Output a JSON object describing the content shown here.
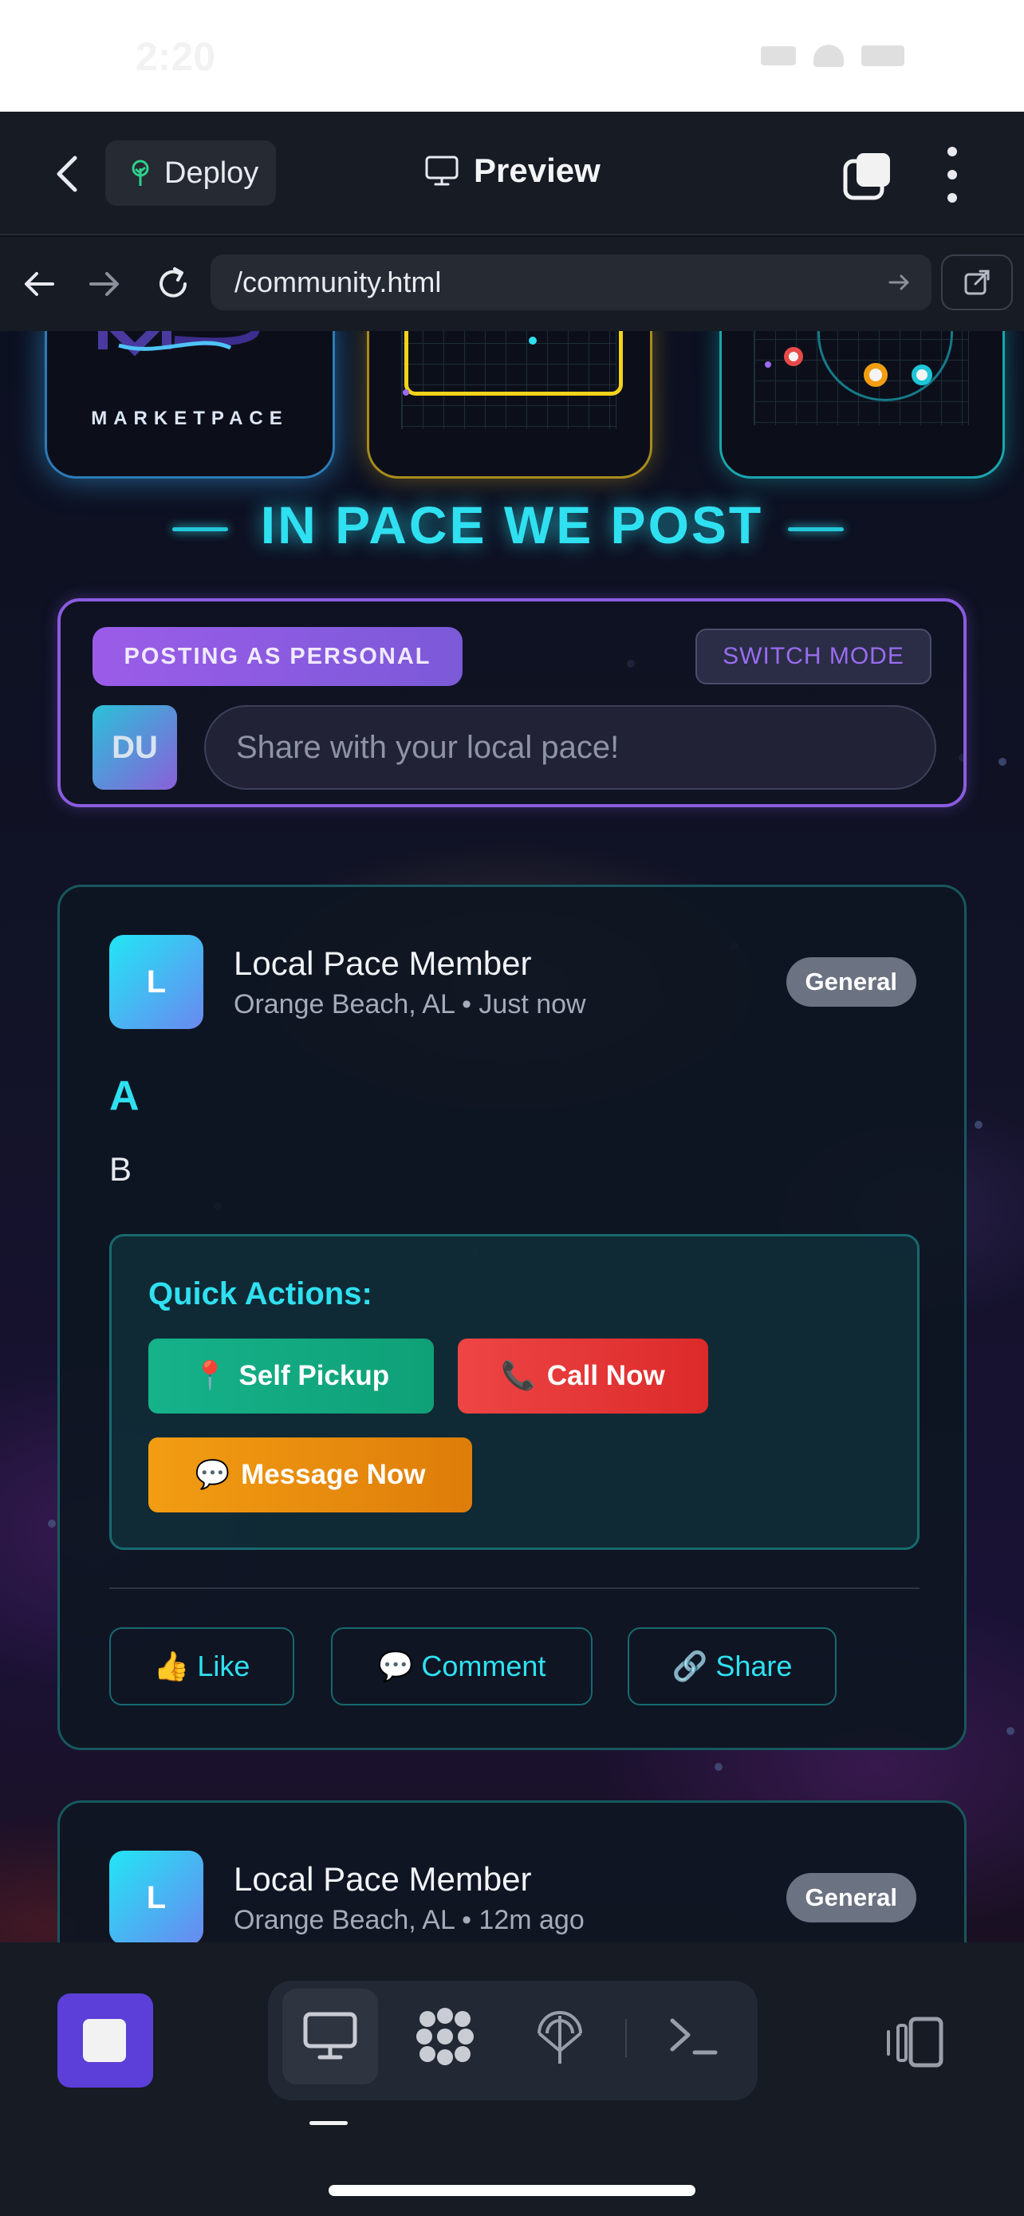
{
  "status": {
    "time": "2:20"
  },
  "header": {
    "deploy_label": "Deploy",
    "preview_label": "Preview"
  },
  "browser": {
    "url": "/community.html"
  },
  "banner": {
    "logo_text": "MARKETPACE"
  },
  "page": {
    "section_title": "IN PACE WE POST",
    "composer": {
      "mode_label": "POSTING AS PERSONAL",
      "switch_label": "SWITCH MODE",
      "avatar_initials": "DU",
      "placeholder": "Share with your local pace!"
    },
    "posts": [
      {
        "avatar": "L",
        "author": "Local Pace Member",
        "location": "Orange Beach, AL",
        "time": "Just now",
        "tag": "General",
        "title": "A",
        "body": "B",
        "quick_actions": {
          "title": "Quick Actions:",
          "self_pickup": {
            "emoji": "📍",
            "label": "Self Pickup"
          },
          "call_now": {
            "emoji": "📞",
            "label": "Call Now"
          },
          "message_now": {
            "emoji": "💬",
            "label": "Message Now"
          }
        },
        "actions": {
          "like": {
            "emoji": "👍",
            "label": "Like"
          },
          "comment": {
            "emoji": "💬",
            "label": "Comment"
          },
          "share": {
            "emoji": "🔗",
            "label": "Share"
          }
        }
      },
      {
        "avatar": "L",
        "author": "Local Pace Member",
        "location": "Orange Beach, AL",
        "time": "12m ago",
        "tag": "General"
      }
    ]
  },
  "colors": {
    "accent_cyan": "#2fe0f0",
    "accent_purple": "#8a5ce0",
    "pickup_green": "#16b28a",
    "call_red": "#ee4545",
    "message_orange": "#f29d12"
  },
  "icons": {
    "back": "chevron-left-icon",
    "deploy": "tree-icon",
    "preview": "monitor-icon",
    "tabs": "tabs-icon",
    "more": "more-vertical-icon",
    "nav_back": "arrow-left-icon",
    "nav_forward": "arrow-right-icon",
    "reload": "reload-icon",
    "open_external": "external-link-icon",
    "stop": "stop-icon",
    "tools": [
      "monitor-icon",
      "packages-icon",
      "deploy-icon",
      "terminal-icon"
    ],
    "devices": "devices-icon"
  }
}
